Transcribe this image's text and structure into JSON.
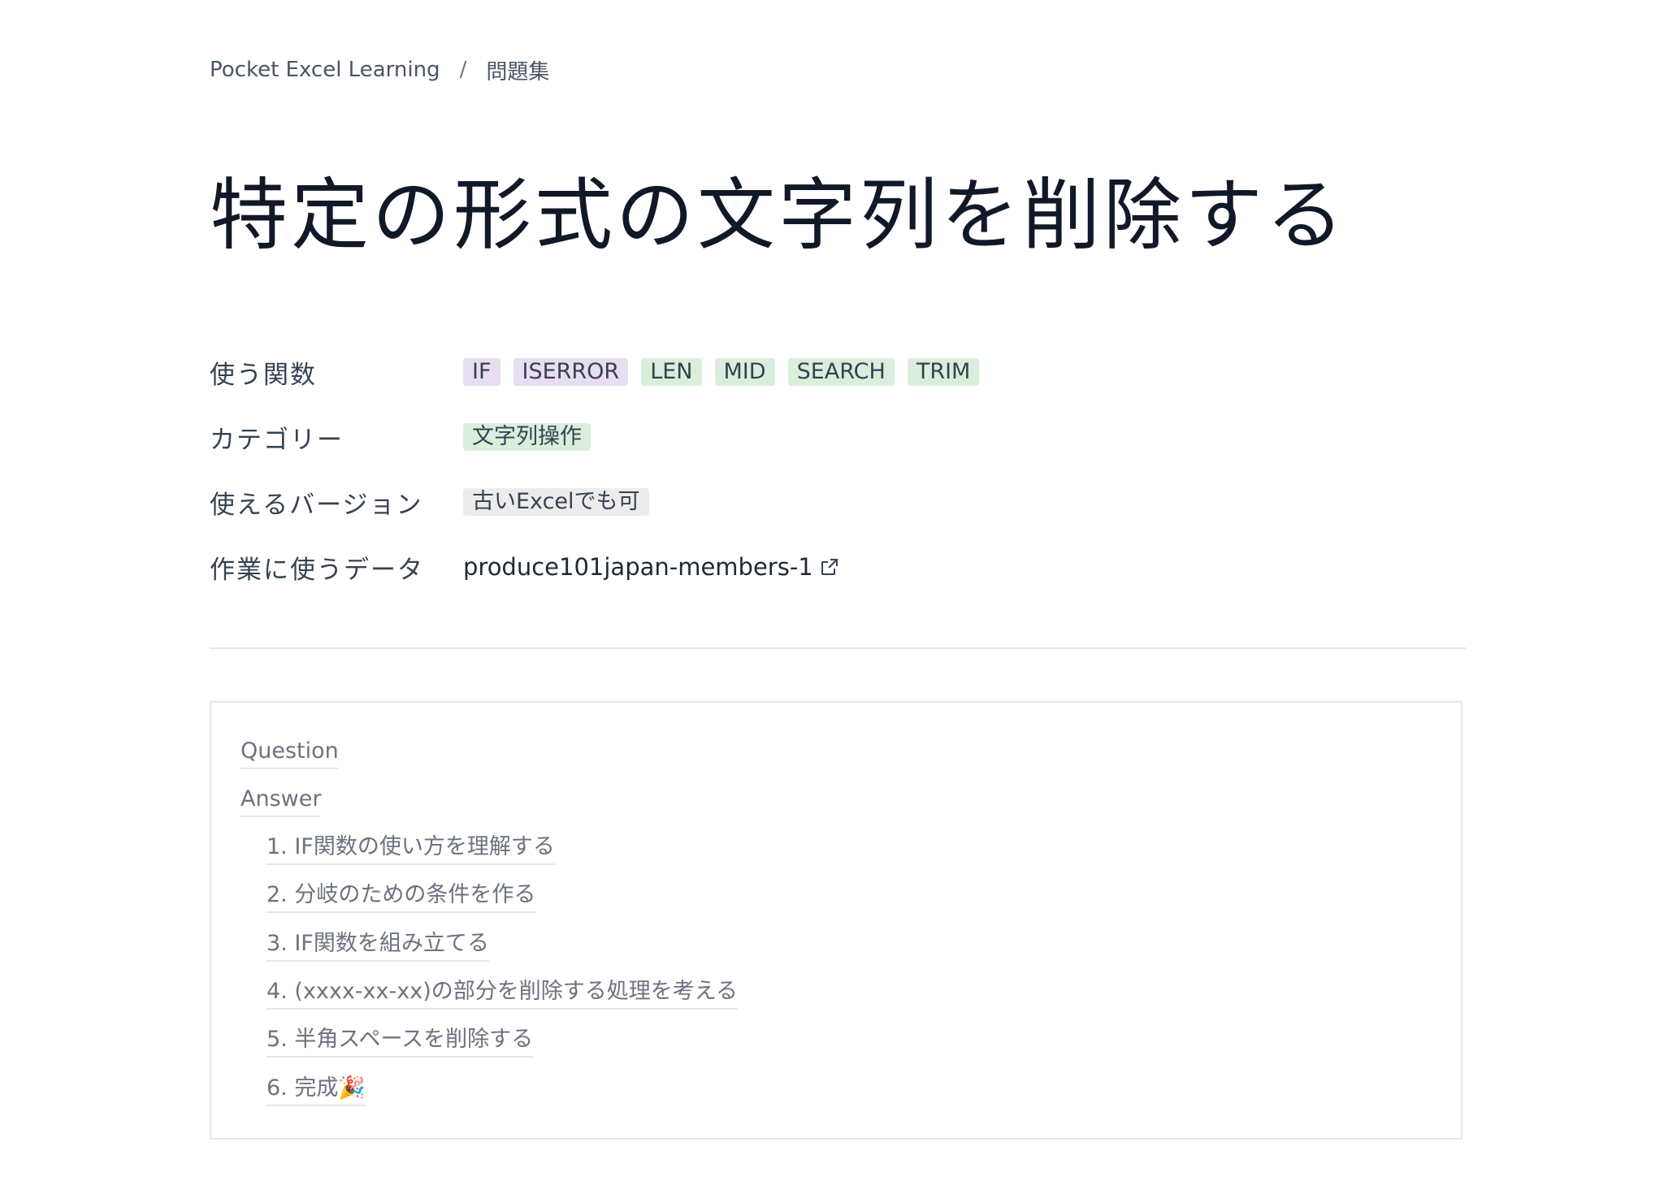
{
  "breadcrumb": {
    "home": "Pocket Excel Learning",
    "separator": "/",
    "current": "問題集"
  },
  "page": {
    "title": "特定の形式の文字列を削除する"
  },
  "properties": {
    "functions": {
      "label": "使う関数",
      "tags": [
        {
          "text": "IF",
          "color": "#e8def1"
        },
        {
          "text": "ISERROR",
          "color": "#e8def1"
        },
        {
          "text": "LEN",
          "color": "#dbeedc"
        },
        {
          "text": "MID",
          "color": "#dbeedc"
        },
        {
          "text": "SEARCH",
          "color": "#dbeedc"
        },
        {
          "text": "TRIM",
          "color": "#dbeedc"
        }
      ]
    },
    "category": {
      "label": "カテゴリー",
      "tags": [
        {
          "text": "文字列操作",
          "color": "#dbeedc"
        }
      ]
    },
    "version": {
      "label": "使えるバージョン",
      "tags": [
        {
          "text": "古いExcelでも可",
          "color": "#ececec"
        }
      ]
    },
    "data": {
      "label": "作業に使うデータ",
      "link_text": "produce101japan-members-1",
      "link_icon": "external-link-icon"
    }
  },
  "toc": {
    "items": [
      {
        "text": "Question",
        "level": 1
      },
      {
        "text": "Answer",
        "level": 1
      },
      {
        "text": "1. IF関数の使い方を理解する",
        "level": 2
      },
      {
        "text": "2. 分岐のための条件を作る",
        "level": 2
      },
      {
        "text": "3. IF関数を組み立てる",
        "level": 2
      },
      {
        "text": "4. (xxxx-xx-xx)の部分を削除する処理を考える",
        "level": 2
      },
      {
        "text": "5. 半角スペースを削除する",
        "level": 2
      },
      {
        "text": "6. 完成🎉",
        "level": 2
      }
    ]
  }
}
